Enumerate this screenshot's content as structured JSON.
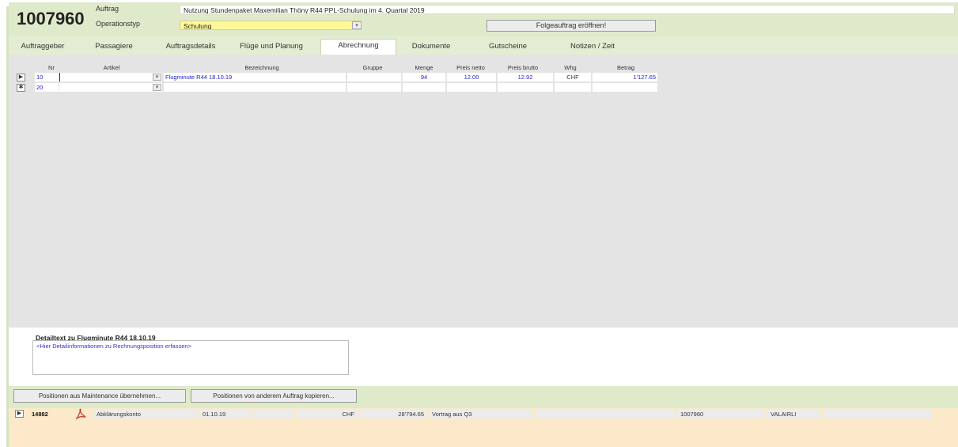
{
  "header": {
    "order_number": "1007960",
    "label_auftrag": "Auftrag",
    "label_operationstyp": "Operationstyp",
    "auftrag_value": "Nutzung Stundenpaket Maxemilian Thöny R44 PPL-Schulung im 4. Quartal 2019",
    "operationstyp_value": "Schulung",
    "folgeauftrag_button": "Folgeauftrag eröffnen!"
  },
  "tabs": [
    {
      "label": "Auftraggeber"
    },
    {
      "label": "Passagiere"
    },
    {
      "label": "Auftragsdetails"
    },
    {
      "label": "Flüge und Planung"
    },
    {
      "label": "Abrechnung",
      "active": true
    },
    {
      "label": "Dokumente"
    },
    {
      "label": "Gutscheine"
    },
    {
      "label": "Notizen / Zeit"
    }
  ],
  "grid": {
    "columns": {
      "nr": "Nr",
      "artikel": "Artikel",
      "bezeichnung": "Bezeichnung",
      "gruppe": "Gruppe",
      "menge": "Menge",
      "preis_netto": "Preis netto",
      "preis_brutto": "Preis brutto",
      "whg": "Whg",
      "betrag": "Betrag"
    },
    "rows": [
      {
        "selector": "▶",
        "nr": "10",
        "artikel": "",
        "bezeichnung": "Flugminute R44 18.10.19",
        "gruppe": "",
        "menge": "94",
        "preis_netto": "12.00",
        "preis_brutto": "12.92",
        "whg": "CHF",
        "betrag": "1'127.65"
      },
      {
        "selector": "✱",
        "nr": "20",
        "artikel": "",
        "bezeichnung": "",
        "gruppe": "",
        "menge": "",
        "preis_netto": "",
        "preis_brutto": "",
        "whg": "",
        "betrag": ""
      }
    ]
  },
  "detail": {
    "title": "Detailtext zu Flugminute R44 18.10.19",
    "placeholder": "<Hier Detailinformationen zu Rechnungsposition erfassen>"
  },
  "actions": {
    "maintenance_button": "Positionen aus Maintenance übernehmen...",
    "copy_button": "Positionen von anderem Auftrag kopieren..."
  },
  "bottom_row": {
    "selector": "▶",
    "id": "14882",
    "konto": "Abklärungskonto",
    "datum": "01.10.19",
    "whg": "CHF",
    "betrag": "28'794.65",
    "text": "Vortrag aus Q3",
    "auftrag": "1007960",
    "user": "VALAIRLI"
  },
  "colors": {
    "header_bg": "#dfeacb",
    "grid_bg": "#e4e4e4",
    "bottom_bg": "#fbe9c9",
    "highlight_field": "#fff899",
    "value_text": "#2222cc"
  }
}
